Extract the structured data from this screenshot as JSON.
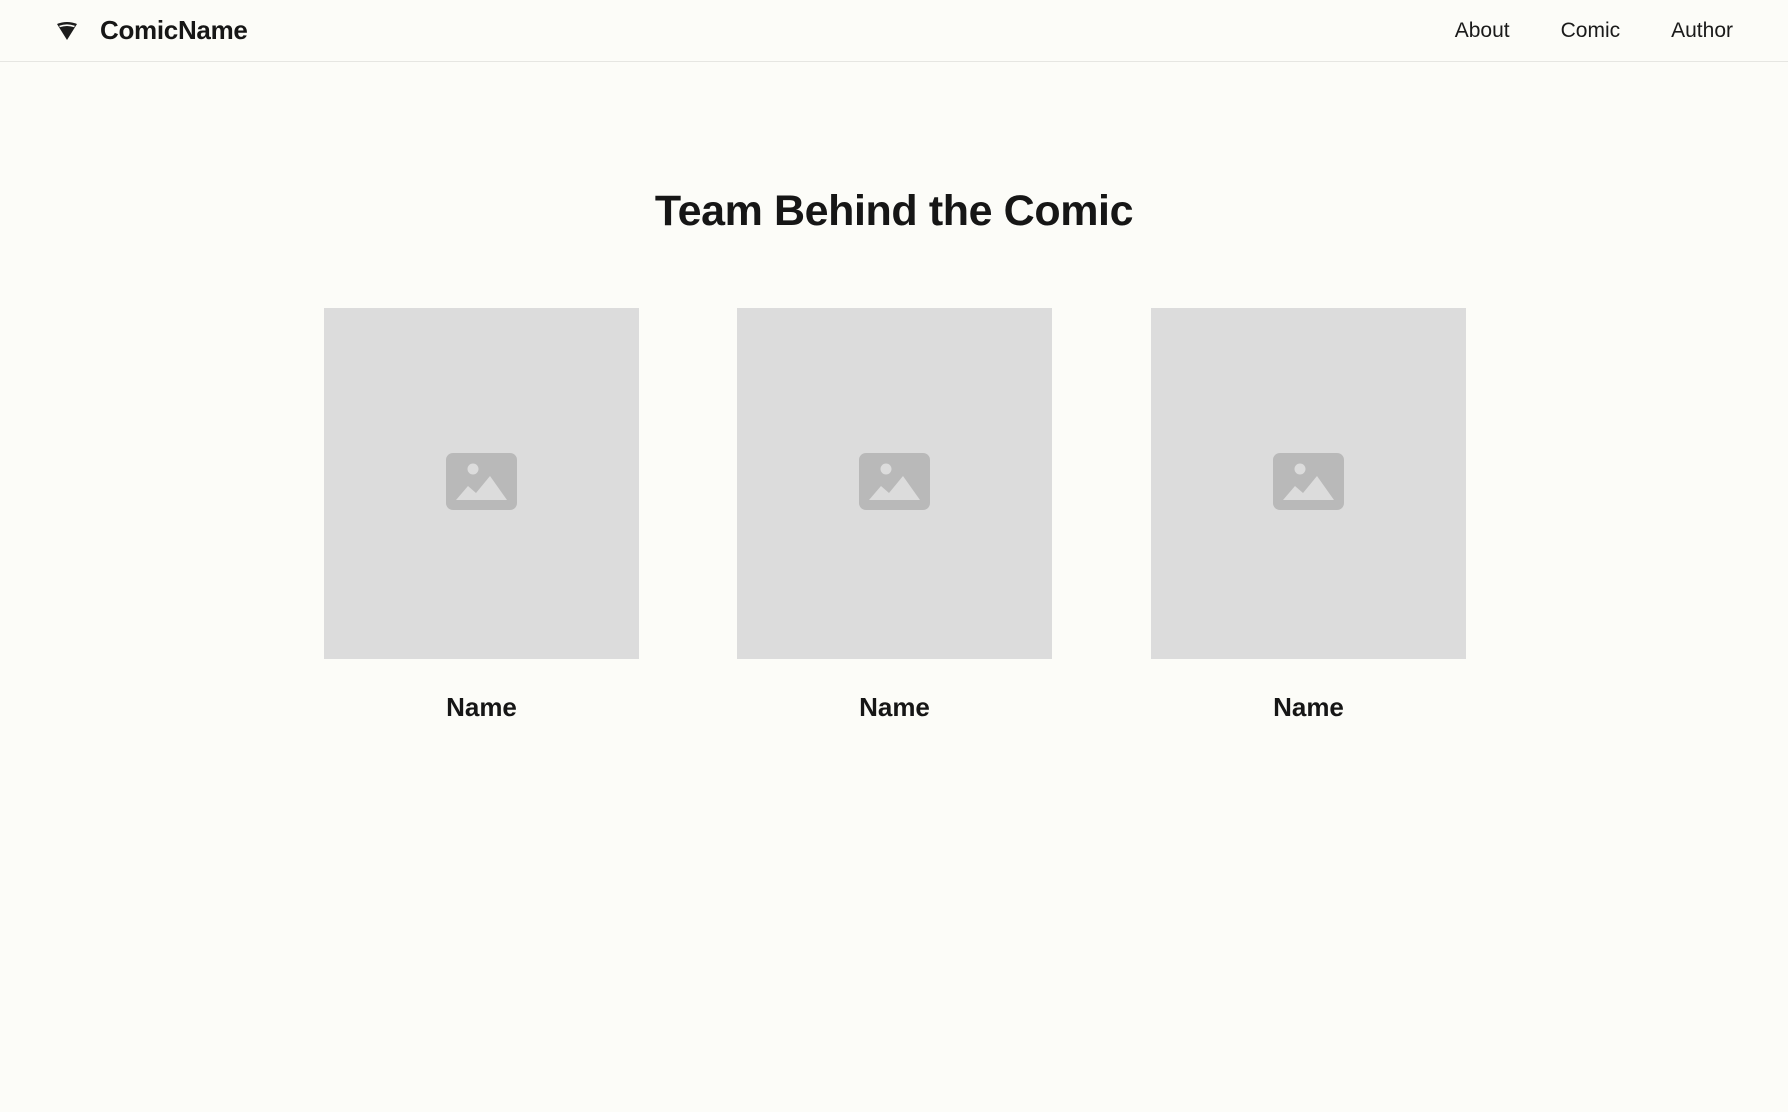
{
  "nav": {
    "brand": "ComicName",
    "logo_icon": "diamond-icon",
    "links": [
      "About",
      "Comic",
      "Author"
    ]
  },
  "main": {
    "heading": "Team Behind the Comic",
    "members": [
      {
        "name": "Name",
        "photo_icon": "image-placeholder-icon"
      },
      {
        "name": "Name",
        "photo_icon": "image-placeholder-icon"
      },
      {
        "name": "Name",
        "photo_icon": "image-placeholder-icon"
      }
    ]
  },
  "colors": {
    "background": "#fcfcf8",
    "placeholder": "#dcdcdc",
    "placeholder_icon": "#b9b9b9",
    "text": "#161616"
  }
}
